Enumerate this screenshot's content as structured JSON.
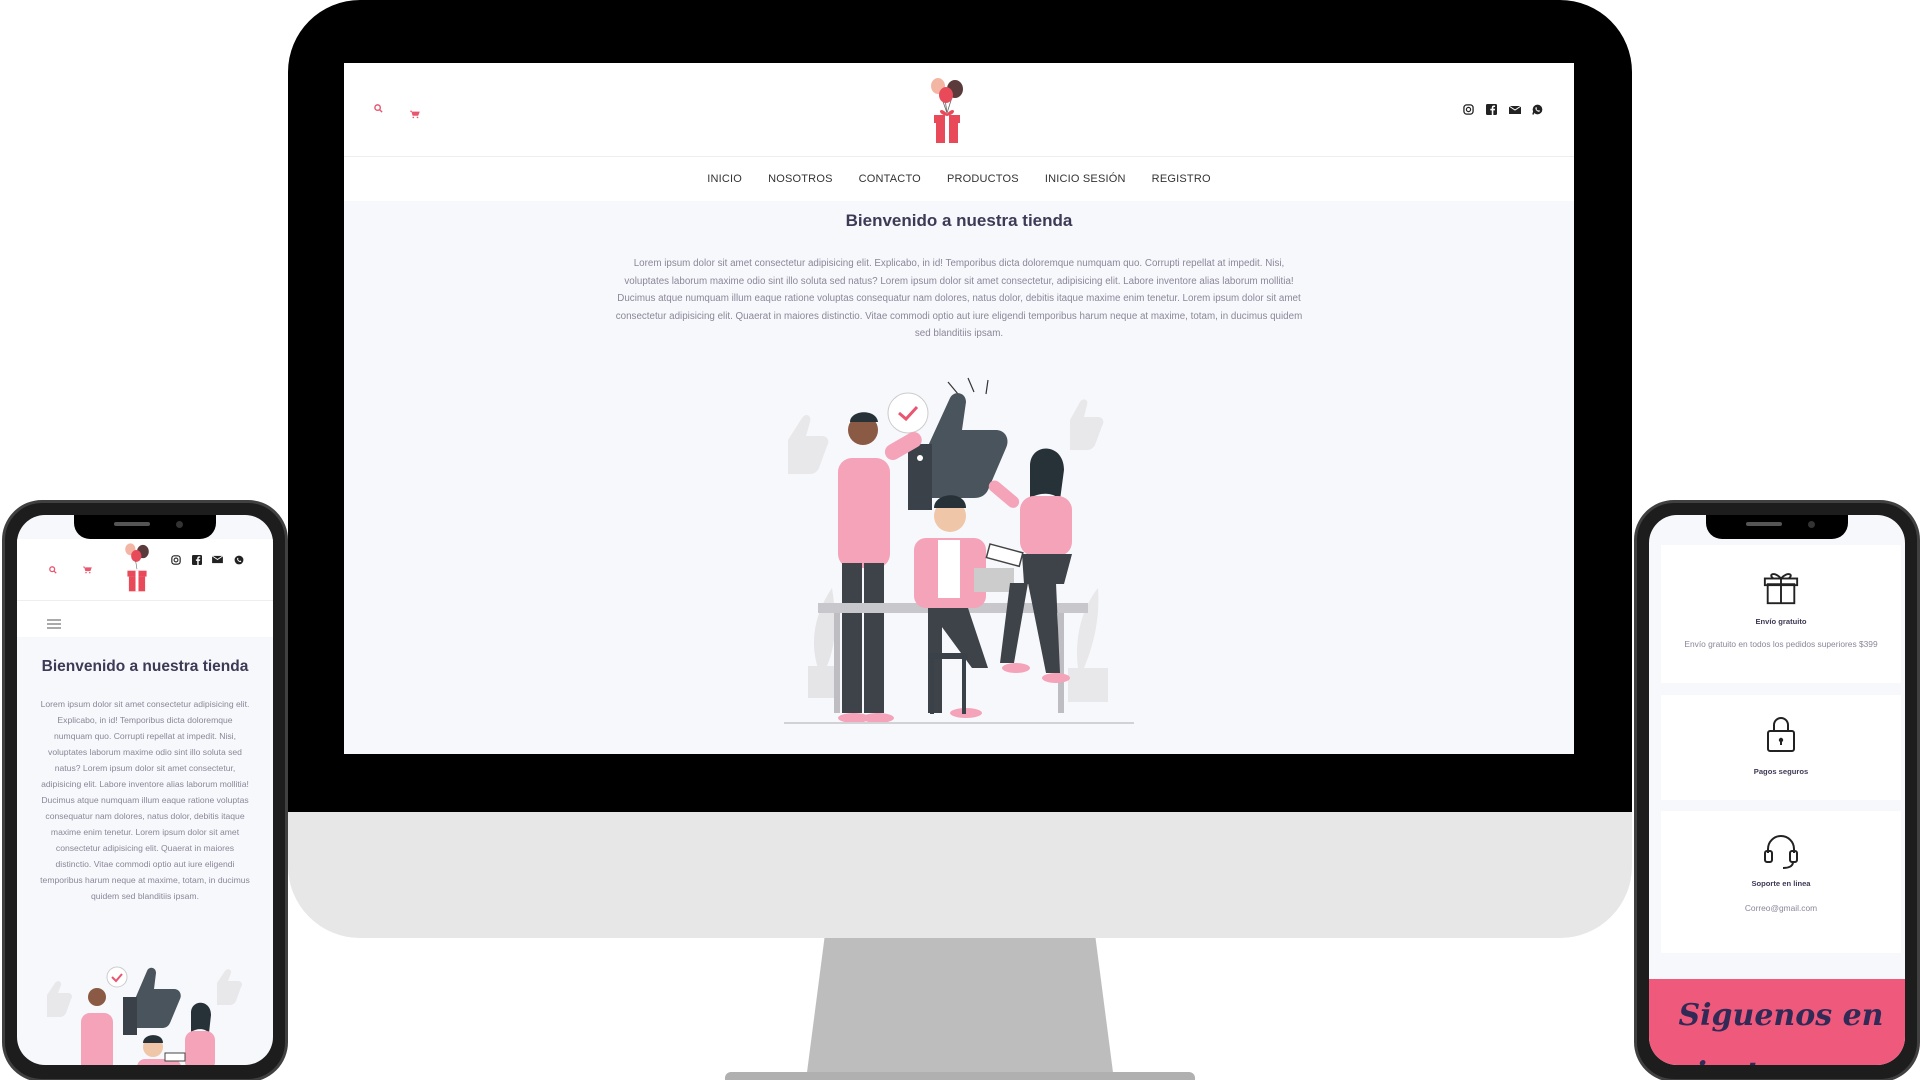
{
  "desktop": {
    "nav": [
      "INICIO",
      "NOSOTROS",
      "CONTACTO",
      "PRODUCTOS",
      "INICIO SESIÓN",
      "REGISTRO"
    ],
    "title": "Bienvenido a nuestra tienda",
    "body": "Lorem ipsum dolor sit amet consectetur adipisicing elit. Explicabo, in id! Temporibus dicta doloremque numquam quo. Corrupti repellat at impedit. Nisi, voluptates laborum maxime odio sint illo soluta sed natus? Lorem ipsum dolor sit amet consectetur, adipisicing elit. Labore inventore alias laborum mollitia! Ducimus atque numquam illum eaque ratione voluptas consequatur nam dolores, natus dolor, debitis itaque maxime enim tenetur. Lorem ipsum dolor sit amet consectetur adipisicing elit. Quaerat in maiores distinctio. Vitae commodi optio aut iure eligendi temporibus harum neque at maxime, totam, in ducimus quidem sed blanditiis ipsam."
  },
  "mobile_left": {
    "title": "Bienvenido a nuestra tienda",
    "body": "Lorem ipsum dolor sit amet consectetur adipisicing elit. Explicabo, in id! Temporibus dicta doloremque numquam quo. Corrupti repellat at impedit. Nisi, voluptates laborum maxime odio sint illo soluta sed natus? Lorem ipsum dolor sit amet consectetur, adipisicing elit. Labore inventore alias laborum mollitia! Ducimus atque numquam illum eaque ratione voluptas consequatur nam dolores, natus dolor, debitis itaque maxime enim tenetur. Lorem ipsum dolor sit amet consectetur adipisicing elit. Quaerat in maiores distinctio. Vitae commodi optio aut iure eligendi temporibus harum neque at maxime, totam, in ducimus quidem sed blanditiis ipsam."
  },
  "mobile_right": {
    "features": [
      {
        "name": "Envío gratuito",
        "desc": "Envío gratuito en todos los pedidos superiores $399"
      },
      {
        "name": "Pagos seguros",
        "desc": ""
      },
      {
        "name": "Soporte en linea",
        "desc": "Correo@gmail.com"
      }
    ],
    "instagram_heading": "Siguenos en instagram"
  },
  "colors": {
    "accent": "#e8566f",
    "title": "#3d3a55",
    "insta_band": "#ef5a7c"
  },
  "icons": [
    "search-icon",
    "cart-icon",
    "instagram-icon",
    "facebook-icon",
    "mail-icon",
    "whatsapp-icon",
    "gift-icon",
    "lock-icon",
    "headset-icon",
    "menu-icon",
    "logo-gift-balloons"
  ]
}
